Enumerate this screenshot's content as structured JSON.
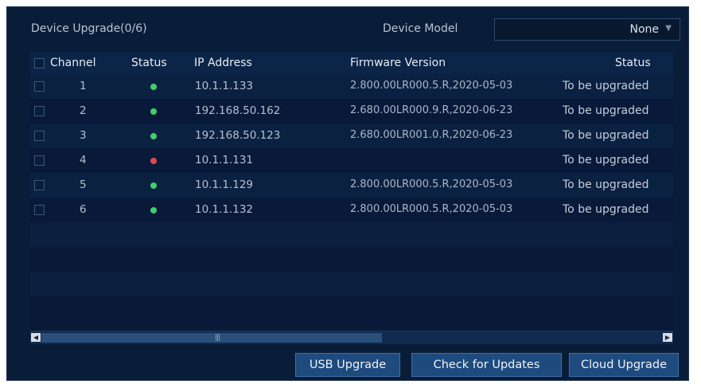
{
  "header": {
    "title": "Device Upgrade(0/6)",
    "model_label": "Device Model",
    "model_value": "None"
  },
  "table": {
    "columns": [
      "Channel",
      "Status",
      "IP Address",
      "Firmware Version",
      "Status"
    ],
    "rows": [
      {
        "channel": "1",
        "online": true,
        "ip": "10.1.1.133",
        "firmware": "2.800.00LR000.5.R,2020-05-03",
        "status": "To be upgraded"
      },
      {
        "channel": "2",
        "online": true,
        "ip": "192.168.50.162",
        "firmware": "2.680.00LR000.9.R,2020-06-23",
        "status": "To be upgraded"
      },
      {
        "channel": "3",
        "online": true,
        "ip": "192.168.50.123",
        "firmware": "2.680.00LR001.0.R,2020-06-23",
        "status": "To be upgraded"
      },
      {
        "channel": "4",
        "online": false,
        "ip": "10.1.1.131",
        "firmware": "",
        "status": "To be upgraded"
      },
      {
        "channel": "5",
        "online": true,
        "ip": "10.1.1.129",
        "firmware": "2.800.00LR000.5.R,2020-05-03",
        "status": "To be upgraded"
      },
      {
        "channel": "6",
        "online": true,
        "ip": "10.1.1.132",
        "firmware": "2.800.00LR000.5.R,2020-05-03",
        "status": "To be upgraded"
      }
    ]
  },
  "buttons": {
    "usb": "USB Upgrade",
    "check": "Check for Updates",
    "cloud": "Cloud Upgrade"
  },
  "icons": {
    "scroll_left": "scroll-left-arrow-icon",
    "scroll_right": "scroll-right-arrow-icon",
    "dropdown": "chevron-down-icon"
  },
  "colors": {
    "online": "#3fd06a",
    "offline": "#e04a4a",
    "panel": "#0a1d38"
  }
}
